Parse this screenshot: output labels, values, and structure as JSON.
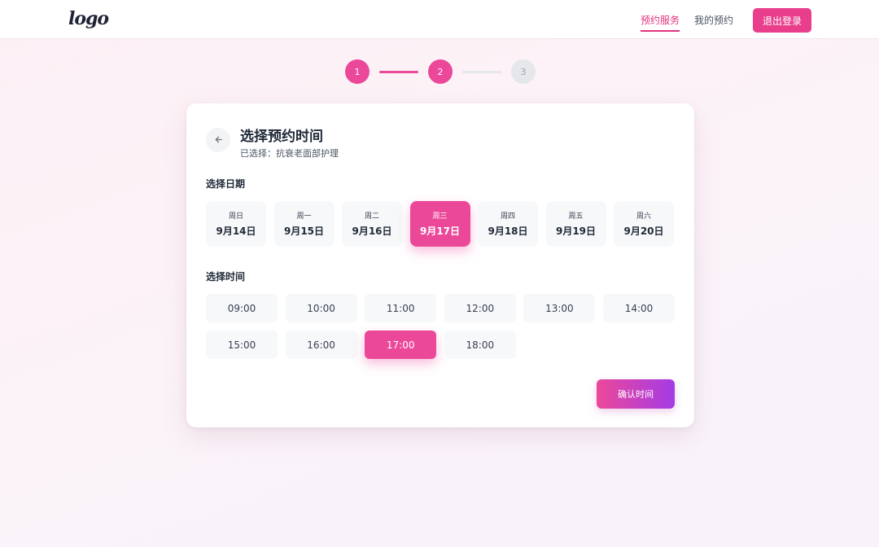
{
  "header": {
    "logo": "logo",
    "nav": {
      "services": "预约服务",
      "my_bookings": "我的预约"
    },
    "logout": "退出登录"
  },
  "stepper": {
    "steps": [
      "1",
      "2",
      "3"
    ],
    "current": 2
  },
  "card": {
    "back_icon": "arrow-left-icon",
    "title": "选择预约时间",
    "subtitle": "已选择：抗衰老面部护理",
    "date_section": "选择日期",
    "dates": [
      {
        "weekday": "周日",
        "date": "9月14日"
      },
      {
        "weekday": "周一",
        "date": "9月15日"
      },
      {
        "weekday": "周二",
        "date": "9月16日"
      },
      {
        "weekday": "周三",
        "date": "9月17日",
        "selected": true
      },
      {
        "weekday": "周四",
        "date": "9月18日"
      },
      {
        "weekday": "周五",
        "date": "9月19日"
      },
      {
        "weekday": "周六",
        "date": "9月20日"
      }
    ],
    "time_section": "选择时间",
    "times": [
      "09:00",
      "10:00",
      "11:00",
      "12:00",
      "13:00",
      "14:00",
      "15:00",
      "16:00",
      "17:00",
      "18:00"
    ],
    "selected_time": "17:00",
    "confirm": "确认时间"
  },
  "colors": {
    "accent": "#ec4899",
    "gradient_end": "#a43be6"
  }
}
